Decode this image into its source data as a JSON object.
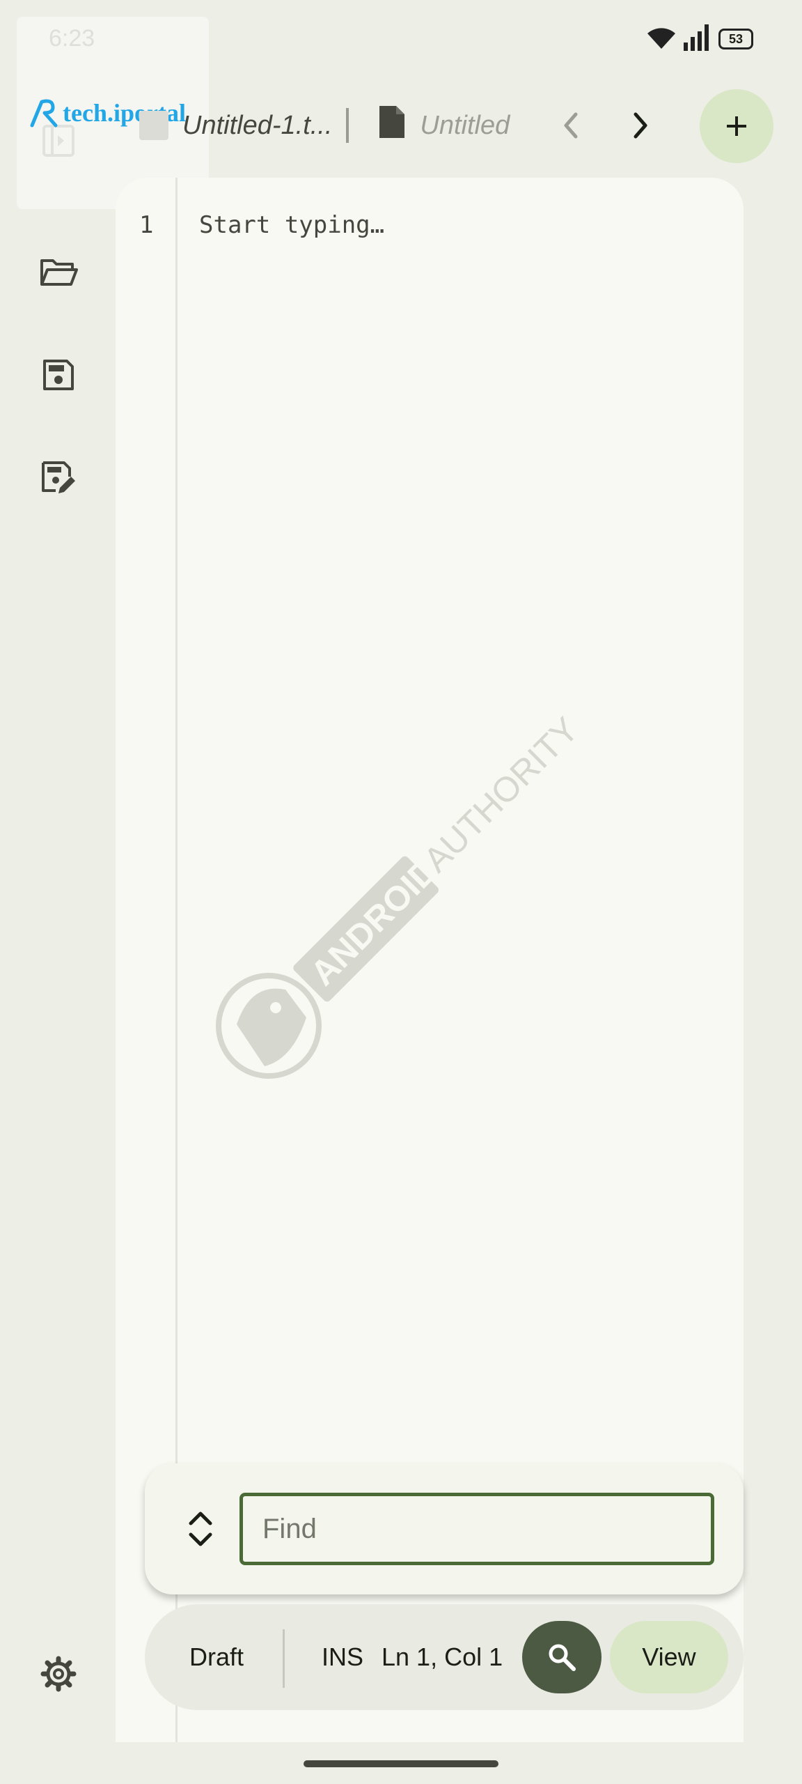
{
  "status_bar": {
    "time": "6:23",
    "battery": "53",
    "icons": [
      "wifi-icon",
      "signal-icon",
      "battery-icon"
    ]
  },
  "watermark": {
    "logo_text": "tech.iportal",
    "center_text": "ANDROID AUTHORITY"
  },
  "rail": {
    "icons": [
      "sidebar-toggle-icon",
      "folder-open-icon",
      "save-icon",
      "save-as-icon",
      "settings-icon"
    ]
  },
  "tabs": [
    {
      "label": "Untitled-1.t...",
      "icon": "file-icon"
    },
    {
      "label": "Untitled",
      "icon": "file-icon"
    }
  ],
  "editor": {
    "line_number": "1",
    "placeholder": "Start typing…"
  },
  "find": {
    "placeholder": "Find",
    "value": ""
  },
  "toolbar": {
    "draft": "Draft",
    "mode": "INS",
    "position": "Ln 1, Col 1",
    "view": "View"
  },
  "colors": {
    "background": "#edeee6",
    "editor": "#f8f9f2",
    "accent_container": "#d9e7c6",
    "find_border": "#4a6b35",
    "search_button": "#4c5a44"
  }
}
